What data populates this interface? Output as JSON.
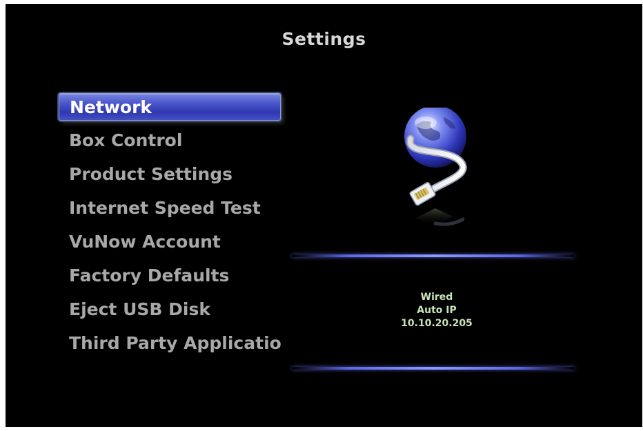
{
  "screen": {
    "title": "Settings"
  },
  "menu": {
    "items": [
      {
        "label": "Network",
        "selected": true
      },
      {
        "label": "Box Control"
      },
      {
        "label": "Product Settings"
      },
      {
        "label": "Internet Speed Test"
      },
      {
        "label": "VuNow Account"
      },
      {
        "label": "Factory Defaults"
      },
      {
        "label": "Eject USB Disk"
      },
      {
        "label": "Third Party Applicatio"
      }
    ]
  },
  "preview": {
    "icon": "globe-ethernet-icon",
    "connection_type": "Wired",
    "ip_mode": "Auto IP",
    "ip_address": "10.10.20.205"
  },
  "colors": {
    "background": "#000000",
    "selection": "#3d47c2",
    "menu_text": "#a8a8a8",
    "status_text": "#c9e4b8",
    "divider": "#6f7cf5"
  }
}
